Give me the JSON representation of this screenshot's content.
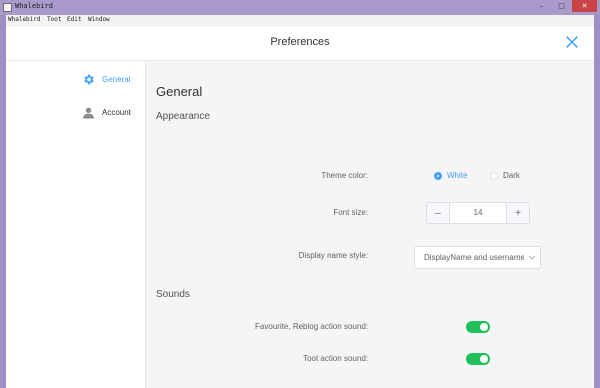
{
  "titlebar": {
    "title": "Whalebird"
  },
  "menu": [
    "Whalebird",
    "Toot",
    "Edit",
    "Window"
  ],
  "header": {
    "title": "Preferences"
  },
  "sidebar": {
    "items": [
      {
        "label": "General",
        "icon": "gear-icon",
        "active": true
      },
      {
        "label": "Account",
        "icon": "user-icon",
        "active": false
      }
    ]
  },
  "main": {
    "title": "General",
    "appearance": {
      "section": "Appearance",
      "theme_label": "Theme color:",
      "theme_options": [
        "White",
        "Dark"
      ],
      "theme_selected": "White",
      "font_label": "Font size:",
      "font_size": "14",
      "display_label": "Display name style:",
      "display_value": "DisplayName and username"
    },
    "sounds": {
      "section": "Sounds",
      "fav_label": "Favourite, Reblog action sound:",
      "fav_on": true,
      "toot_label": "Toot action sound:",
      "toot_on": true
    }
  },
  "colors": {
    "accent": "#409eff",
    "toggle_on": "#1fbf5a",
    "titlebar": "#a99acb"
  }
}
